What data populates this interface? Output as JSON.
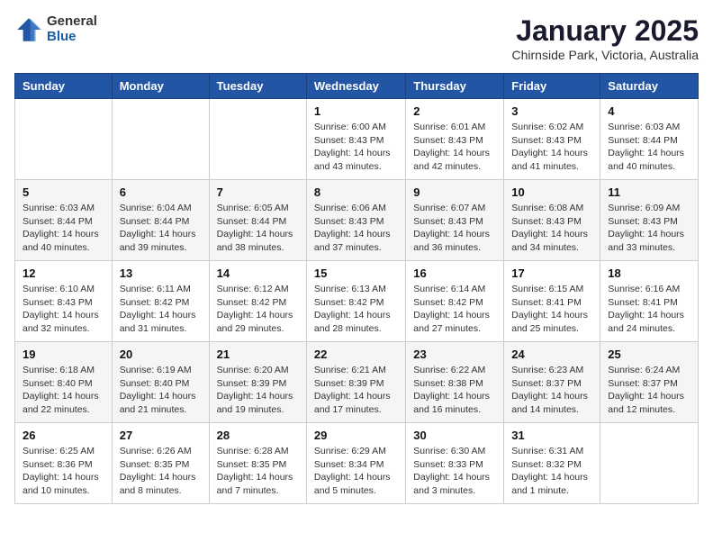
{
  "logo": {
    "general": "General",
    "blue": "Blue"
  },
  "title": "January 2025",
  "subtitle": "Chirnside Park, Victoria, Australia",
  "days_of_week": [
    "Sunday",
    "Monday",
    "Tuesday",
    "Wednesday",
    "Thursday",
    "Friday",
    "Saturday"
  ],
  "weeks": [
    [
      {
        "day": "",
        "info": ""
      },
      {
        "day": "",
        "info": ""
      },
      {
        "day": "",
        "info": ""
      },
      {
        "day": "1",
        "info": "Sunrise: 6:00 AM\nSunset: 8:43 PM\nDaylight: 14 hours\nand 43 minutes."
      },
      {
        "day": "2",
        "info": "Sunrise: 6:01 AM\nSunset: 8:43 PM\nDaylight: 14 hours\nand 42 minutes."
      },
      {
        "day": "3",
        "info": "Sunrise: 6:02 AM\nSunset: 8:43 PM\nDaylight: 14 hours\nand 41 minutes."
      },
      {
        "day": "4",
        "info": "Sunrise: 6:03 AM\nSunset: 8:44 PM\nDaylight: 14 hours\nand 40 minutes."
      }
    ],
    [
      {
        "day": "5",
        "info": "Sunrise: 6:03 AM\nSunset: 8:44 PM\nDaylight: 14 hours\nand 40 minutes."
      },
      {
        "day": "6",
        "info": "Sunrise: 6:04 AM\nSunset: 8:44 PM\nDaylight: 14 hours\nand 39 minutes."
      },
      {
        "day": "7",
        "info": "Sunrise: 6:05 AM\nSunset: 8:44 PM\nDaylight: 14 hours\nand 38 minutes."
      },
      {
        "day": "8",
        "info": "Sunrise: 6:06 AM\nSunset: 8:43 PM\nDaylight: 14 hours\nand 37 minutes."
      },
      {
        "day": "9",
        "info": "Sunrise: 6:07 AM\nSunset: 8:43 PM\nDaylight: 14 hours\nand 36 minutes."
      },
      {
        "day": "10",
        "info": "Sunrise: 6:08 AM\nSunset: 8:43 PM\nDaylight: 14 hours\nand 34 minutes."
      },
      {
        "day": "11",
        "info": "Sunrise: 6:09 AM\nSunset: 8:43 PM\nDaylight: 14 hours\nand 33 minutes."
      }
    ],
    [
      {
        "day": "12",
        "info": "Sunrise: 6:10 AM\nSunset: 8:43 PM\nDaylight: 14 hours\nand 32 minutes."
      },
      {
        "day": "13",
        "info": "Sunrise: 6:11 AM\nSunset: 8:42 PM\nDaylight: 14 hours\nand 31 minutes."
      },
      {
        "day": "14",
        "info": "Sunrise: 6:12 AM\nSunset: 8:42 PM\nDaylight: 14 hours\nand 29 minutes."
      },
      {
        "day": "15",
        "info": "Sunrise: 6:13 AM\nSunset: 8:42 PM\nDaylight: 14 hours\nand 28 minutes."
      },
      {
        "day": "16",
        "info": "Sunrise: 6:14 AM\nSunset: 8:42 PM\nDaylight: 14 hours\nand 27 minutes."
      },
      {
        "day": "17",
        "info": "Sunrise: 6:15 AM\nSunset: 8:41 PM\nDaylight: 14 hours\nand 25 minutes."
      },
      {
        "day": "18",
        "info": "Sunrise: 6:16 AM\nSunset: 8:41 PM\nDaylight: 14 hours\nand 24 minutes."
      }
    ],
    [
      {
        "day": "19",
        "info": "Sunrise: 6:18 AM\nSunset: 8:40 PM\nDaylight: 14 hours\nand 22 minutes."
      },
      {
        "day": "20",
        "info": "Sunrise: 6:19 AM\nSunset: 8:40 PM\nDaylight: 14 hours\nand 21 minutes."
      },
      {
        "day": "21",
        "info": "Sunrise: 6:20 AM\nSunset: 8:39 PM\nDaylight: 14 hours\nand 19 minutes."
      },
      {
        "day": "22",
        "info": "Sunrise: 6:21 AM\nSunset: 8:39 PM\nDaylight: 14 hours\nand 17 minutes."
      },
      {
        "day": "23",
        "info": "Sunrise: 6:22 AM\nSunset: 8:38 PM\nDaylight: 14 hours\nand 16 minutes."
      },
      {
        "day": "24",
        "info": "Sunrise: 6:23 AM\nSunset: 8:37 PM\nDaylight: 14 hours\nand 14 minutes."
      },
      {
        "day": "25",
        "info": "Sunrise: 6:24 AM\nSunset: 8:37 PM\nDaylight: 14 hours\nand 12 minutes."
      }
    ],
    [
      {
        "day": "26",
        "info": "Sunrise: 6:25 AM\nSunset: 8:36 PM\nDaylight: 14 hours\nand 10 minutes."
      },
      {
        "day": "27",
        "info": "Sunrise: 6:26 AM\nSunset: 8:35 PM\nDaylight: 14 hours\nand 8 minutes."
      },
      {
        "day": "28",
        "info": "Sunrise: 6:28 AM\nSunset: 8:35 PM\nDaylight: 14 hours\nand 7 minutes."
      },
      {
        "day": "29",
        "info": "Sunrise: 6:29 AM\nSunset: 8:34 PM\nDaylight: 14 hours\nand 5 minutes."
      },
      {
        "day": "30",
        "info": "Sunrise: 6:30 AM\nSunset: 8:33 PM\nDaylight: 14 hours\nand 3 minutes."
      },
      {
        "day": "31",
        "info": "Sunrise: 6:31 AM\nSunset: 8:32 PM\nDaylight: 14 hours\nand 1 minute."
      },
      {
        "day": "",
        "info": ""
      }
    ]
  ]
}
